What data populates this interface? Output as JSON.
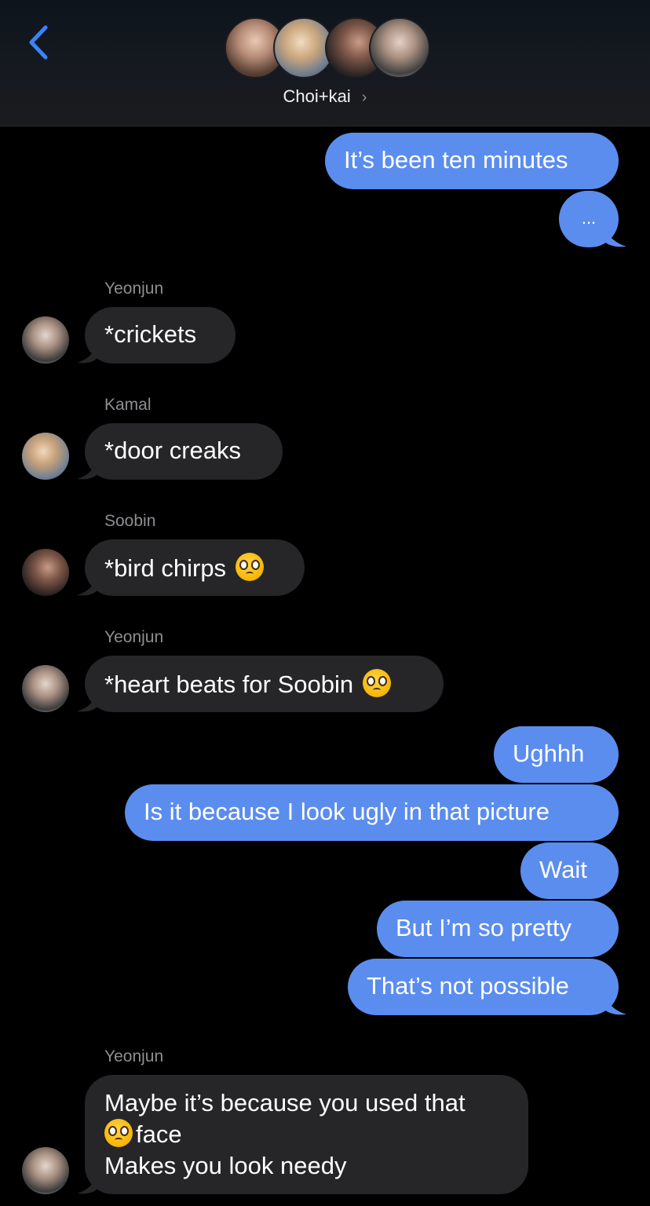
{
  "header": {
    "title": "Choi+kai",
    "title_chevron": "›",
    "avatars": [
      {
        "name": "group-avatar-1"
      },
      {
        "name": "group-avatar-2"
      },
      {
        "name": "group-avatar-3"
      },
      {
        "name": "group-avatar-4"
      }
    ]
  },
  "colors": {
    "outgoing_bubble": "#5b8def",
    "incoming_bubble": "#262628",
    "accent": "#3a84f5",
    "sender_name": "#8e8e93"
  },
  "messages": {
    "m1": "It’s been ten minutes",
    "m2": "...",
    "m3_sender": "Yeonjun",
    "m3": "*crickets",
    "m4_sender": "Kamal",
    "m4": "*door creaks",
    "m5_sender": "Soobin",
    "m5": "*bird chirps",
    "m6_sender": "Yeonjun",
    "m6": "*heart beats for Soobin",
    "m7": "Ughhh",
    "m8": "Is it because I look ugly in that picture",
    "m9": "Wait",
    "m10": "But I’m so pretty",
    "m11": "That’s not possible",
    "m12_sender": "Yeonjun",
    "m12_line1": "Maybe it’s because you used that",
    "m12_line2": "face",
    "m12_line3": "Makes you look needy"
  }
}
